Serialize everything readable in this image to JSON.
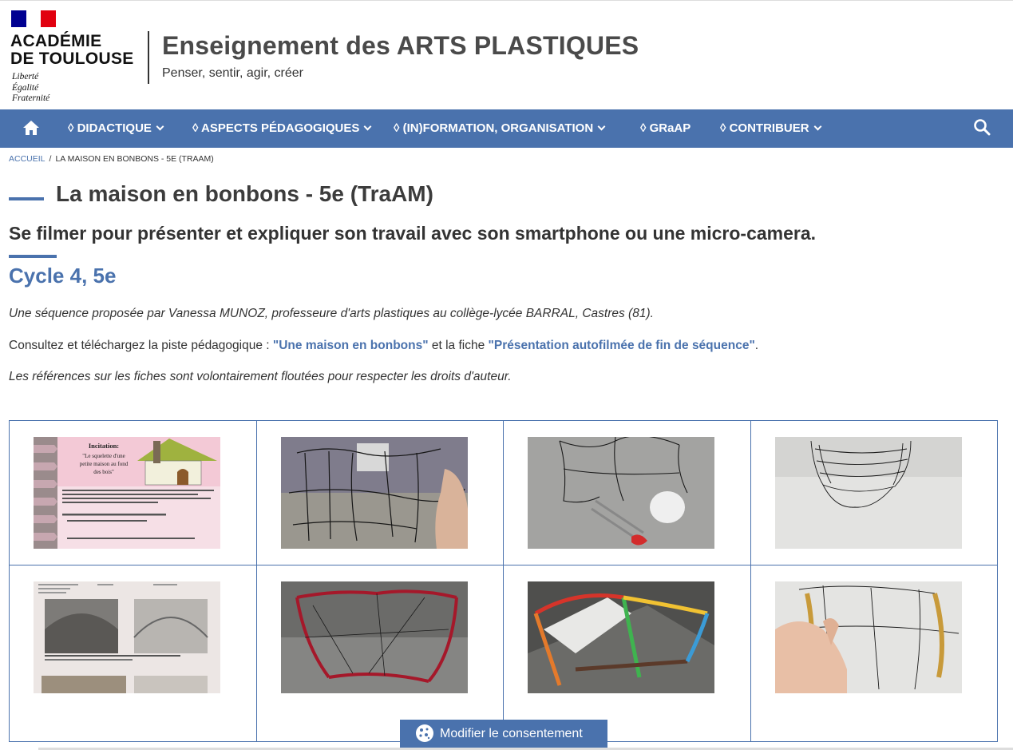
{
  "header": {
    "academie": "ACADÉMIE\nDE TOULOUSE",
    "motto": [
      "Liberté",
      "Égalité",
      "Fraternité"
    ],
    "site_title": "Enseignement des ARTS PLASTIQUES",
    "site_subtitle": "Penser, sentir, agir, créer"
  },
  "nav": {
    "home_icon": "home-icon",
    "items": [
      {
        "label": "◊ DIDACTIQUE"
      },
      {
        "label": "◊ ASPECTS PÉDAGOGIQUES"
      },
      {
        "label": "◊ (IN)FORMATION, ORGANISATION"
      },
      {
        "label": "◊ GRaAP"
      },
      {
        "label": "◊ CONTRIBUER"
      }
    ],
    "search_icon": "search-icon",
    "accent": "#4a72ad"
  },
  "breadcrumb": {
    "home": "ACCUEIL",
    "separator": "/",
    "current": "LA MAISON EN BONBONS - 5E (TRAAM)"
  },
  "article": {
    "title": "La maison en bonbons - 5e (TraAM)",
    "subtitle": "Se filmer pour présenter et expliquer son travail avec son smartphone ou une micro-camera.",
    "section": "Cycle 4, 5e",
    "intro": "Une séquence proposée par Vanessa MUNOZ, professeure d'arts plastiques au collège-lycée BARRAL, Castres (81).",
    "download_prefix": "Consultez et téléchargez la piste pédagogique : ",
    "link1": "\"Une maison en bonbons\"",
    "download_middle": " et la fiche ",
    "link2": "\"Présentation autofilmée de fin de séquence\"",
    "download_suffix": ".",
    "note": "Les références sur les fiches sont volontairement floutées pour respecter les droits d'auteur."
  },
  "slide": {
    "heading": "Incitation:",
    "quote": [
      "\"Le squelette d'une",
      "petite maison au fond",
      "des bois\""
    ]
  },
  "consent_button": {
    "label": "Modifier le consentement",
    "icon": "cookie-icon"
  }
}
